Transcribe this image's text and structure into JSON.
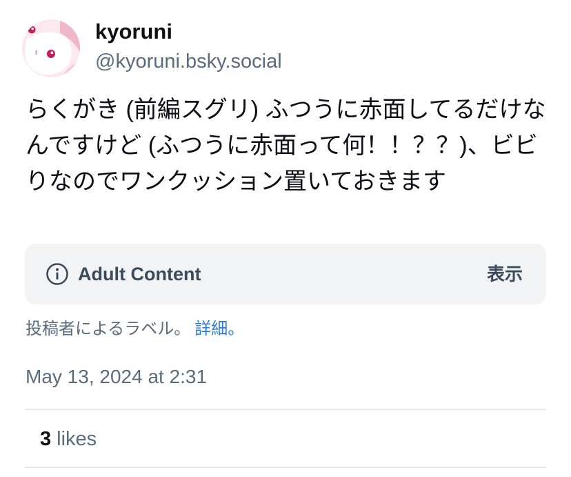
{
  "author": {
    "display_name": "kyoruni",
    "handle": "@kyoruni.bsky.social",
    "avatar_icon": "character-avatar-icon"
  },
  "post": {
    "text": "らくがき (前編スグリ) ふつうに赤面してるだけなんですけど (ふつうに赤面って何！！？？)、ビビりなのでワンクッション置いておきます"
  },
  "content_label": {
    "icon": "info-circle-icon",
    "title": "Adult Content",
    "action": "表示",
    "note": "投稿者によるラベル。",
    "details_link": "詳細。"
  },
  "timestamp": "May 13, 2024 at 2:31",
  "likes": {
    "count": "3",
    "label": "likes"
  },
  "colors": {
    "text_primary": "#0b0f14",
    "text_secondary": "#5a6b7d",
    "label_bg": "#f1f3f5",
    "link": "#2a7ad8",
    "divider": "#e3e7eb"
  }
}
